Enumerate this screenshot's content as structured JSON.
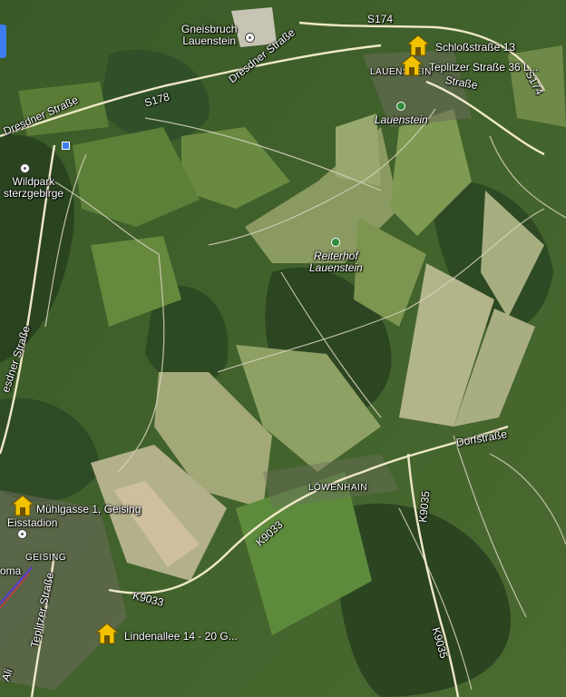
{
  "map": {
    "places": [
      {
        "id": "gneisbruch",
        "text": "Gneisbruch\nLauenstein"
      },
      {
        "id": "wildpark",
        "text": "Wildpark\nsterzgebirge"
      },
      {
        "id": "lauenstein",
        "text": "Lauenstein"
      },
      {
        "id": "lauenstein-town",
        "text": "LAUENSTEIN"
      },
      {
        "id": "reiterhof",
        "text": "Reiterhof\nLauenstein"
      },
      {
        "id": "loewenhain",
        "text": "LÖWENHAIN"
      },
      {
        "id": "geising",
        "text": "GEISING"
      },
      {
        "id": "eisstadion",
        "text": "Eisstadion"
      },
      {
        "id": "oma",
        "text": "oma"
      }
    ],
    "roads": [
      {
        "id": "s174",
        "text": "S174"
      },
      {
        "id": "s178",
        "text": "S178"
      },
      {
        "id": "dresdner-1",
        "text": "Dresdner Straße"
      },
      {
        "id": "dresdner-2",
        "text": "Dresdner Straße"
      },
      {
        "id": "dresdner-3",
        "text": "esdner Straße"
      },
      {
        "id": "teplitzer-top",
        "text": "Straße"
      },
      {
        "id": "s174-right",
        "text": "S174"
      },
      {
        "id": "dorfstrasse",
        "text": "Dorfstraße"
      },
      {
        "id": "k9035-a",
        "text": "K9035"
      },
      {
        "id": "k9035-b",
        "text": "K9035"
      },
      {
        "id": "k9033-a",
        "text": "K9033"
      },
      {
        "id": "k9033-b",
        "text": "K9033"
      },
      {
        "id": "teplitzer-bottom",
        "text": "Teplitzer Straße"
      },
      {
        "id": "left-road-bottom",
        "text": "Ali"
      }
    ],
    "markers": [
      {
        "id": "schlossstrasse",
        "text": "Schloßstraße 13"
      },
      {
        "id": "teplitzer",
        "text": "Teplitzer Straße 36 L..."
      },
      {
        "id": "muehlgasse",
        "text": "Mühlgasse 1, Geising"
      },
      {
        "id": "lindenallee",
        "text": "Lindenallee 14 - 20 G..."
      }
    ],
    "marker_color": "#f2c200",
    "road_color": "#e8e4d8",
    "highway_color": "#f0e9c8"
  }
}
